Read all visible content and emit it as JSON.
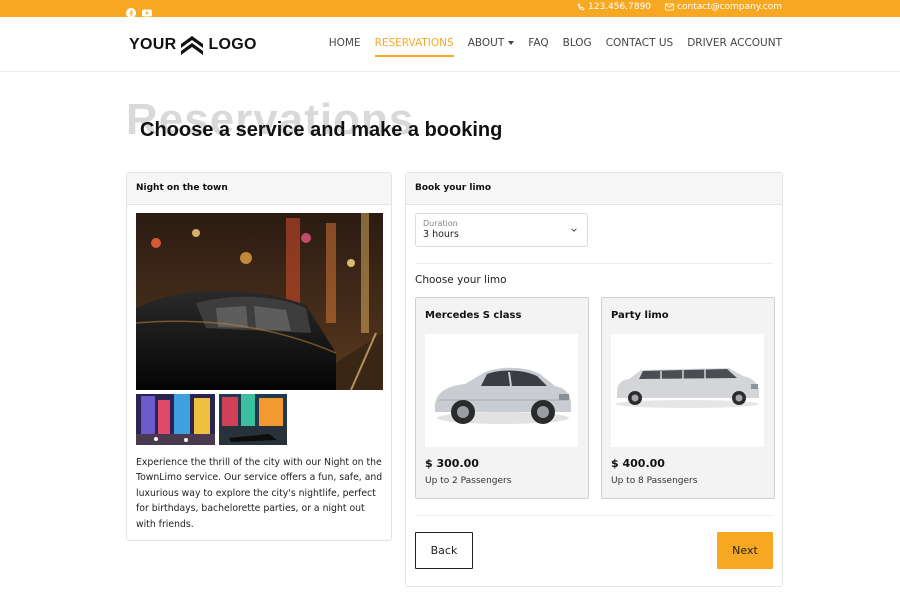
{
  "topbar": {
    "phone": "123.456.7890",
    "email": "contact@company.com"
  },
  "header": {
    "logo_left": "YOUR",
    "logo_right": "LOGO",
    "nav": [
      {
        "label": "HOME"
      },
      {
        "label": "RESERVATIONS"
      },
      {
        "label": "ABOUT"
      },
      {
        "label": "FAQ"
      },
      {
        "label": "BLOG"
      },
      {
        "label": "CONTACT US"
      },
      {
        "label": "DRIVER ACCOUNT"
      }
    ]
  },
  "hero": {
    "watermark": "Reservations",
    "title": "Choose a service and make a booking"
  },
  "service": {
    "heading": "Night on the town",
    "description": "Experience the thrill of the city with our Night on the TownLimo service. Our service offers a fun, safe, and luxurious way to explore the city's nightlife, perfect for birthdays, bachelorette parties, or a night out with friends."
  },
  "booking": {
    "heading": "Book your limo",
    "duration_label": "Duration",
    "duration_value": "3 hours",
    "choose_label": "Choose your limo",
    "limos": [
      {
        "name": "Mercedes S class",
        "price": "$ 300.00",
        "capacity": "Up to 2 Passengers"
      },
      {
        "name": "Party limo",
        "price": "$ 400.00",
        "capacity": "Up to 8 Passengers"
      }
    ],
    "back_label": "Back",
    "next_label": "Next"
  },
  "colors": {
    "accent": "#f7a823",
    "text": "#222222",
    "card_border": "#e3e3e3"
  },
  "icons": [
    "facebook-icon",
    "youtube-icon",
    "phone-icon",
    "mail-icon",
    "chevron-down-icon"
  ]
}
